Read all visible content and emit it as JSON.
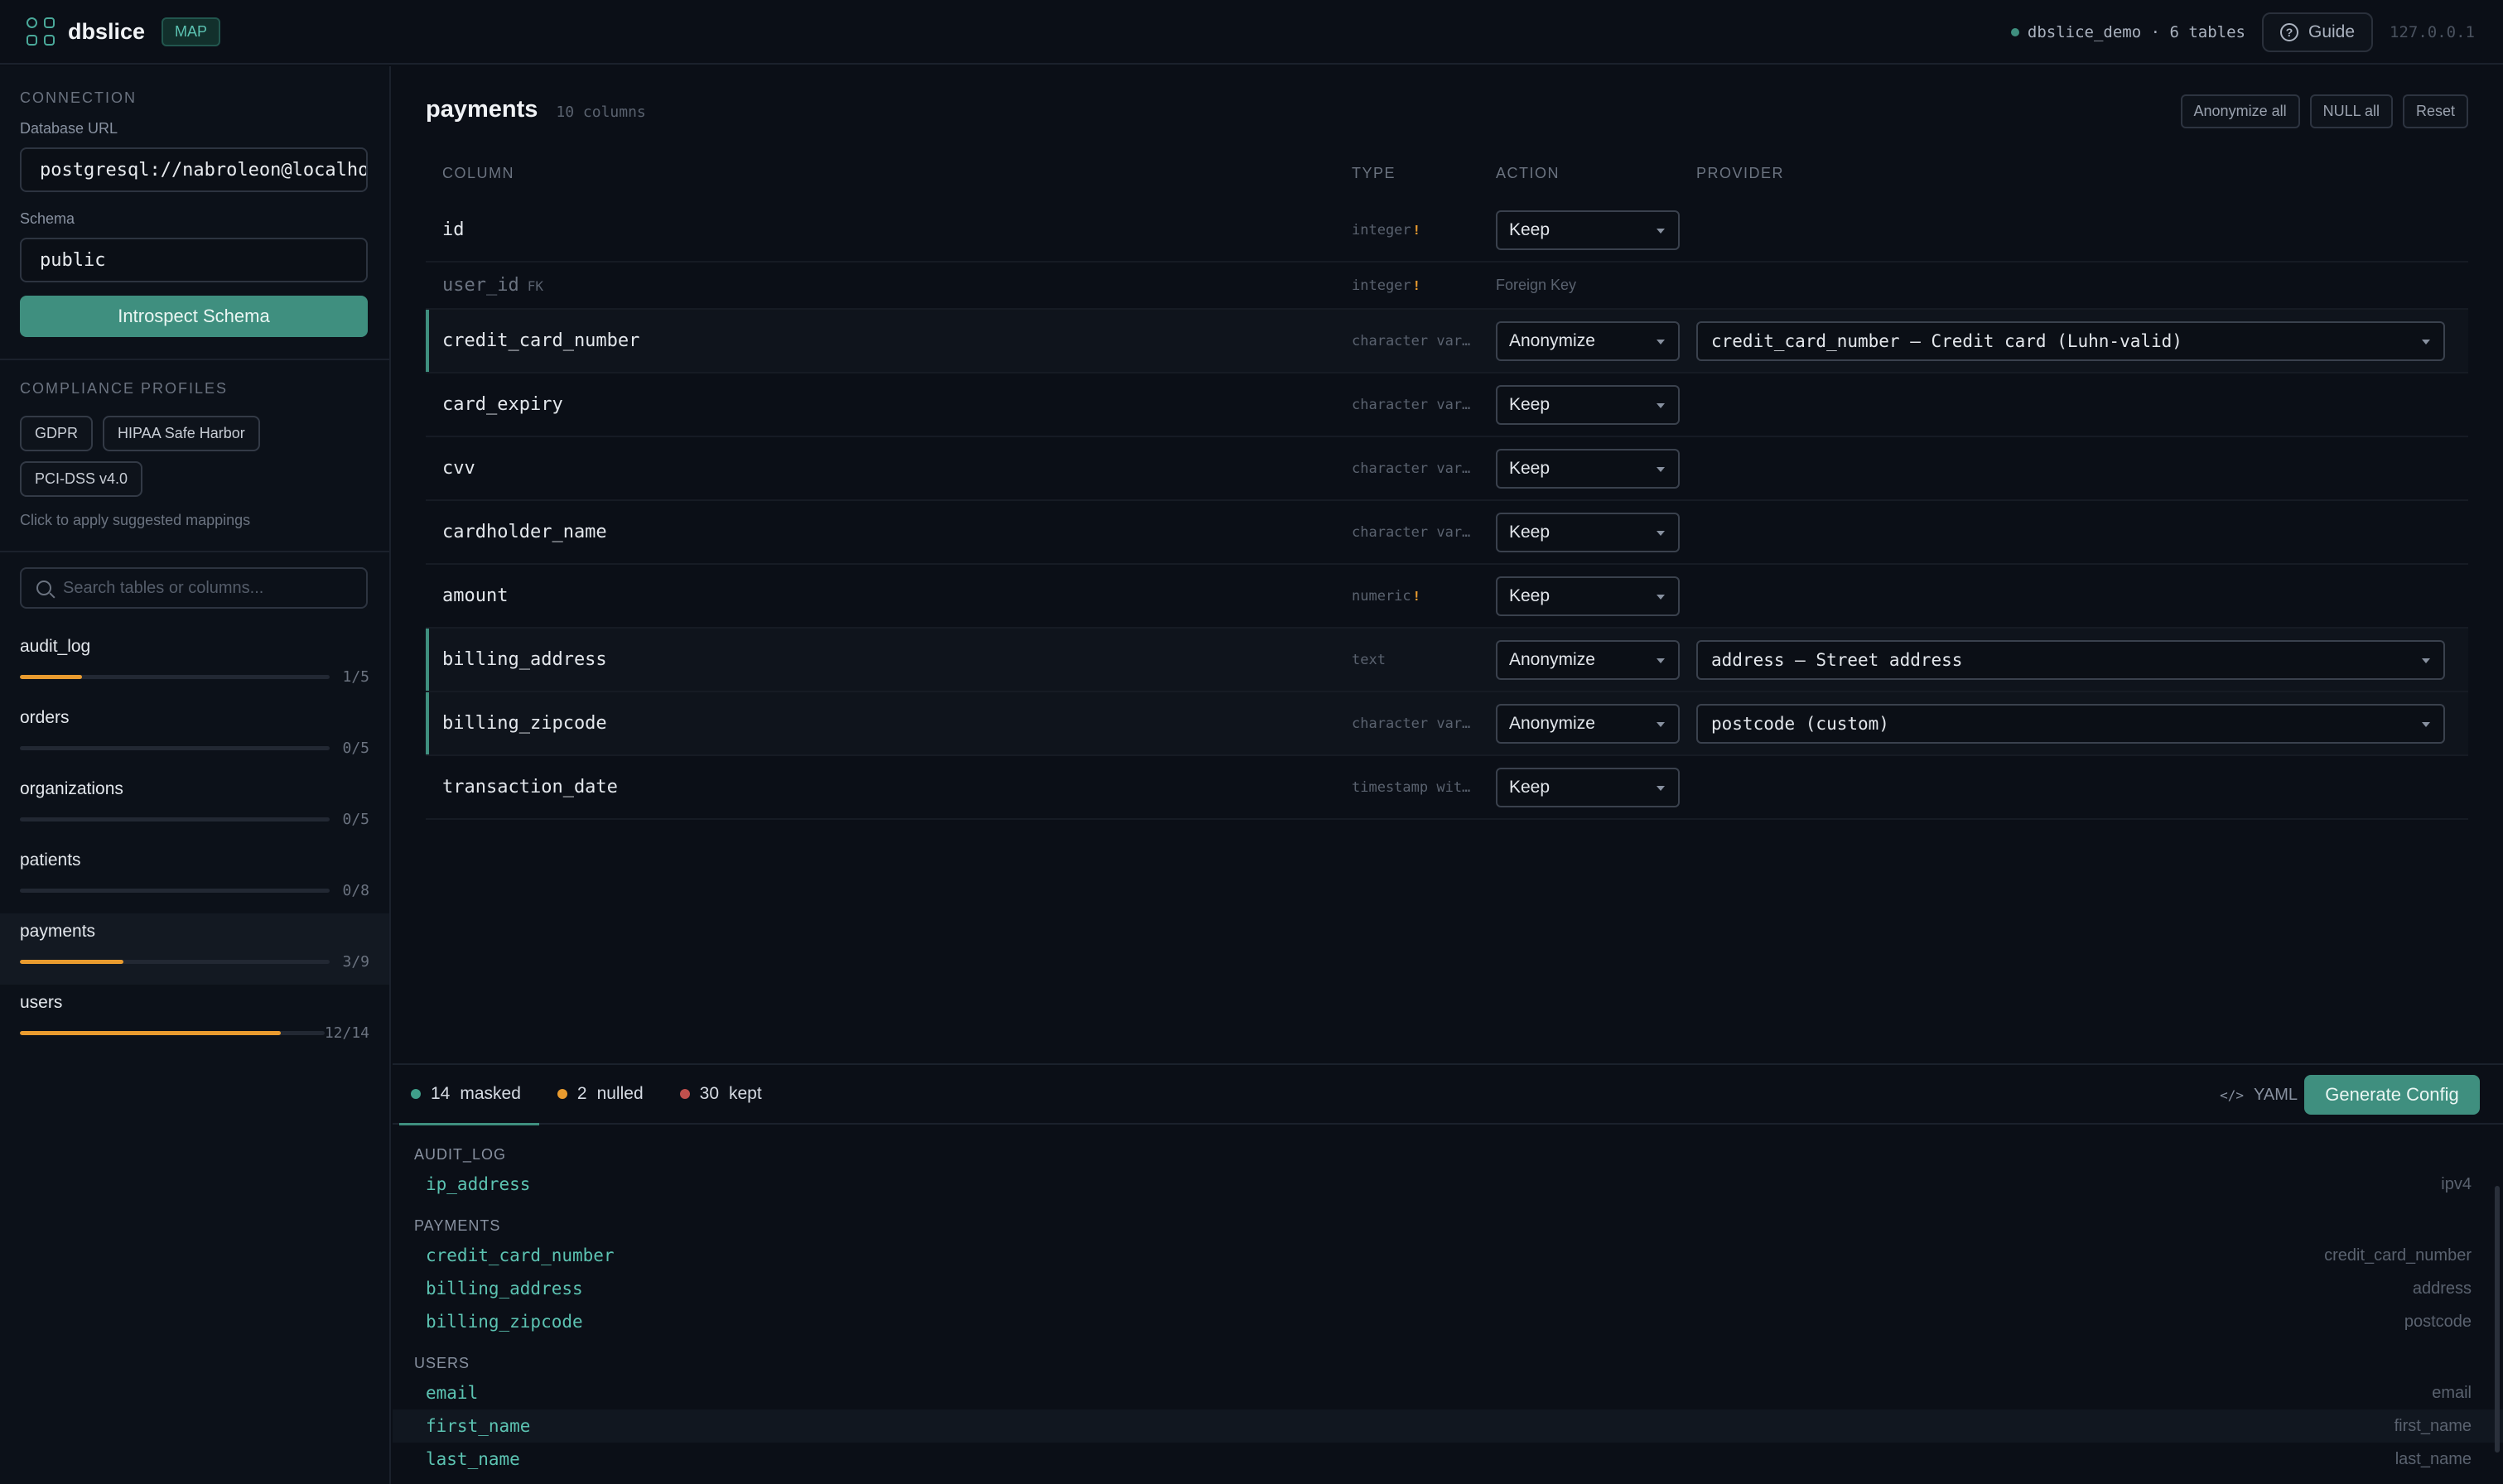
{
  "app": {
    "name": "dbslice",
    "badge": "MAP"
  },
  "header": {
    "db_status": "dbslice_demo · 6 tables",
    "guide_label": "Guide",
    "guide_icon": "help-circle-icon",
    "host": "127.0.0.1"
  },
  "sidebar": {
    "connection_title": "CONNECTION",
    "db_url_label": "Database URL",
    "db_url_value": "postgresql://nabroleon@localhost",
    "schema_label": "Schema",
    "schema_value": "public",
    "introspect_label": "Introspect Schema",
    "profiles_title": "COMPLIANCE PROFILES",
    "profiles": [
      "GDPR",
      "HIPAA Safe Harbor",
      "PCI-DSS v4.0"
    ],
    "profiles_hint": "Click to apply suggested mappings",
    "search_placeholder": "Search tables or columns...",
    "tables": [
      {
        "name": "audit_log",
        "count": "1/5",
        "progress": 0.2
      },
      {
        "name": "orders",
        "count": "0/5",
        "progress": 0
      },
      {
        "name": "organizations",
        "count": "0/5",
        "progress": 0
      },
      {
        "name": "patients",
        "count": "0/8",
        "progress": 0
      },
      {
        "name": "payments",
        "count": "3/9",
        "progress": 0.333,
        "active": true
      },
      {
        "name": "users",
        "count": "12/14",
        "progress": 0.857
      }
    ]
  },
  "main": {
    "title": "payments",
    "column_count": "10 columns",
    "actions": [
      "Anonymize all",
      "NULL all",
      "Reset"
    ],
    "headers": [
      "COLUMN",
      "TYPE",
      "ACTION",
      "PROVIDER"
    ],
    "rows": [
      {
        "name": "id",
        "type": "integer",
        "warn": "!",
        "action": "Keep",
        "provider": ""
      },
      {
        "name": "user_id",
        "fk_tag": "FK",
        "type": "integer",
        "warn": "!",
        "action_text": "Foreign Key"
      },
      {
        "name": "credit_card_number",
        "type": "character var…",
        "action": "Anonymize",
        "provider": "credit_card_number — Credit card (Luhn-valid)",
        "masked": true
      },
      {
        "name": "card_expiry",
        "type": "character var…",
        "action": "Keep",
        "provider": ""
      },
      {
        "name": "cvv",
        "type": "character var…",
        "action": "Keep",
        "provider": ""
      },
      {
        "name": "cardholder_name",
        "type": "character var…",
        "action": "Keep",
        "provider": ""
      },
      {
        "name": "amount",
        "type": "numeric",
        "warn": "!",
        "action": "Keep",
        "provider": ""
      },
      {
        "name": "billing_address",
        "type": "text",
        "action": "Anonymize",
        "provider": "address — Street address",
        "masked": true
      },
      {
        "name": "billing_zipcode",
        "type": "character var…",
        "action": "Anonymize",
        "provider": "postcode (custom)",
        "masked": true
      },
      {
        "name": "transaction_date",
        "type": "timestamp wit…",
        "action": "Keep",
        "provider": ""
      }
    ]
  },
  "bottom": {
    "stats": [
      {
        "count": "14",
        "label": "masked",
        "color": "#3f9f8a"
      },
      {
        "count": "2",
        "label": "nulled",
        "color": "#e99b2f"
      },
      {
        "count": "30",
        "label": "kept",
        "color": "#c0504d"
      }
    ],
    "yaml_label": "YAML",
    "generate_label": "Generate Config",
    "groups": [
      {
        "label": "AUDIT_LOG",
        "items": [
          {
            "column": "ip_address",
            "provider": "ipv4"
          }
        ]
      },
      {
        "label": "PAYMENTS",
        "items": [
          {
            "column": "credit_card_number",
            "provider": "credit_card_number"
          },
          {
            "column": "billing_address",
            "provider": "address"
          },
          {
            "column": "billing_zipcode",
            "provider": "postcode"
          }
        ]
      },
      {
        "label": "USERS",
        "items": [
          {
            "column": "email",
            "provider": "email"
          },
          {
            "column": "first_name",
            "provider": "first_name"
          },
          {
            "column": "last_name",
            "provider": "last_name"
          }
        ]
      }
    ]
  }
}
